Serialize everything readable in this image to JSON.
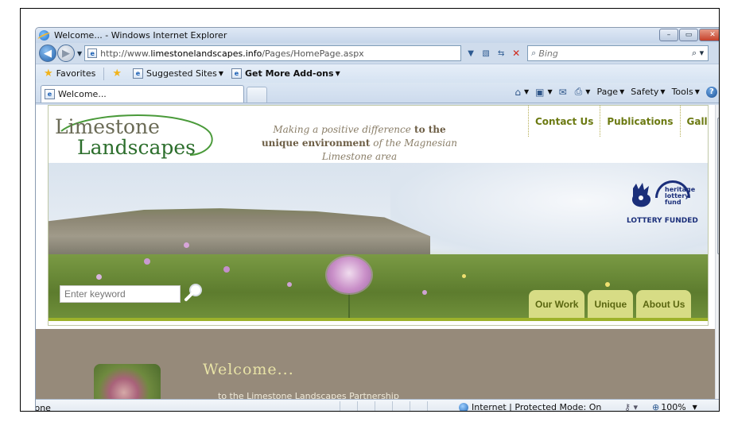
{
  "window": {
    "title": "Welcome... - Windows Internet Explorer",
    "controls": {
      "minimize": "–",
      "maximize": "▭",
      "close": "✕"
    }
  },
  "address": {
    "url_prefix": "http://www.",
    "url_domain": "limestonelandscapes.info",
    "url_path": "/Pages/HomePage.aspx",
    "search_placeholder": "Bing"
  },
  "favorites_bar": {
    "favorites": "Favorites",
    "suggested_sites": "Suggested Sites",
    "addons": "Get More Add-ons"
  },
  "tabs": [
    {
      "label": "Welcome..."
    }
  ],
  "command_bar": {
    "page": "Page",
    "safety": "Safety",
    "tools": "Tools"
  },
  "site": {
    "logo_line1": "Limestone",
    "logo_line2": "Landscapes",
    "tagline": {
      "part1": "Making a positive difference",
      "part2": " to the",
      "part3": "unique environment",
      "part4": " of the Magnesian",
      "part5": "Limestone area"
    },
    "top_nav": [
      "Contact Us",
      "Publications",
      "Gallery"
    ],
    "funder": {
      "line1": "heritage",
      "line2": "lottery fund",
      "label": "LOTTERY FUNDED"
    },
    "search_placeholder": "Enter keyword",
    "section_tabs": [
      "Our Work",
      "Unique",
      "About Us"
    ],
    "welcome_title": "Welcome...",
    "welcome_sub": "to the Limestone Landscapes Partnership"
  },
  "status_bar": {
    "text": "Done",
    "zone": "Internet | Protected Mode: On",
    "zoom": "100%"
  },
  "colors": {
    "nav_green": "#6c7a12",
    "tab_bg": "#d7dc85",
    "welcome_bg": "#968a7a",
    "logo_green": "#2c6e2c"
  }
}
